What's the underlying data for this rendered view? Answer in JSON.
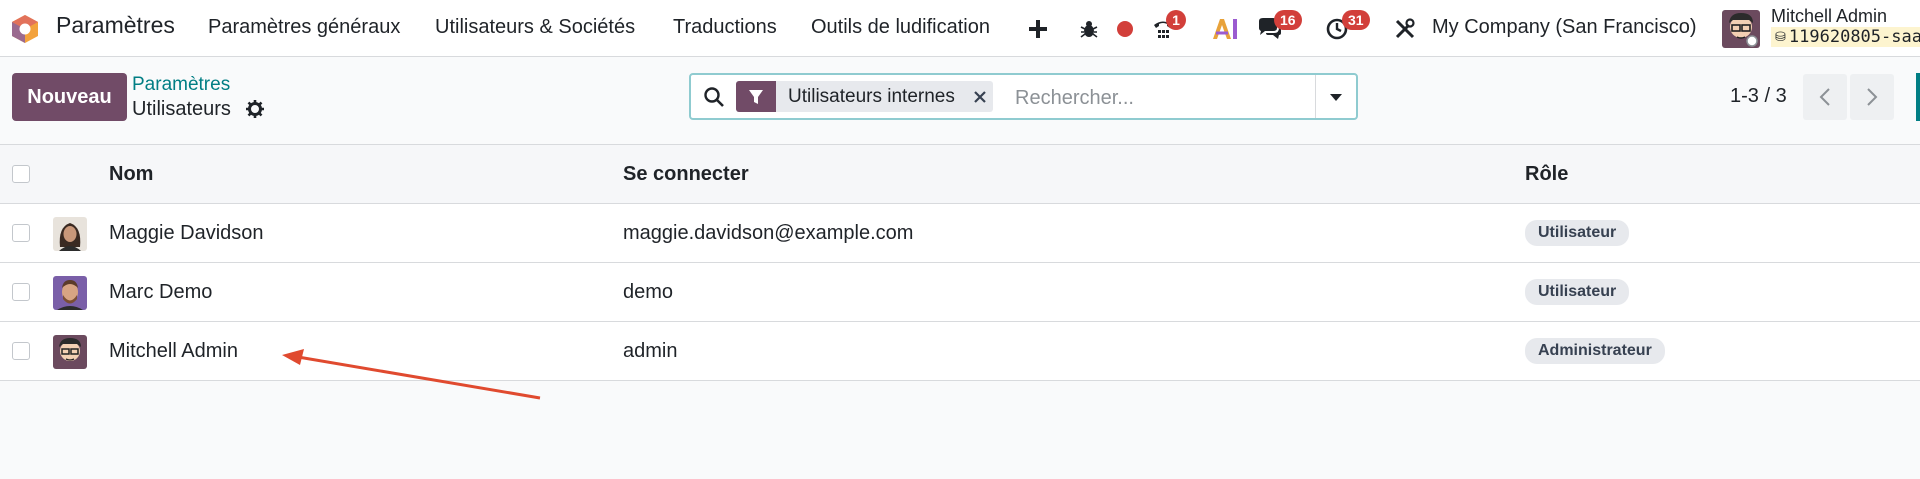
{
  "navbar": {
    "app_name": "Paramètres",
    "menu": [
      {
        "label": "Paramètres généraux"
      },
      {
        "label": "Utilisateurs & Sociétés"
      },
      {
        "label": "Traductions"
      },
      {
        "label": "Outils de ludification"
      }
    ],
    "badges": {
      "phone": "1",
      "messages": "16",
      "activities": "31"
    },
    "company": "My Company (San Francisco)",
    "user_name": "Mitchell Admin",
    "database": "119620805-saa"
  },
  "control_panel": {
    "new_button": "Nouveau",
    "breadcrumb_parent": "Paramètres",
    "breadcrumb_current": "Utilisateurs",
    "search": {
      "facet": "Utilisateurs internes",
      "placeholder": "Rechercher..."
    },
    "pager": "1-3 / 3"
  },
  "list": {
    "columns": {
      "name": "Nom",
      "login": "Se connecter",
      "role": "Rôle"
    },
    "rows": [
      {
        "name": "Maggie Davidson",
        "login": "maggie.davidson@example.com",
        "role": "Utilisateur"
      },
      {
        "name": "Marc Demo",
        "login": "demo",
        "role": "Utilisateur"
      },
      {
        "name": "Mitchell Admin",
        "login": "admin",
        "role": "Administrateur"
      }
    ]
  },
  "colors": {
    "brand": "#714b67",
    "accent": "#017e84",
    "badge": "#d23f3a",
    "annotation_arrow": "#e04a2f"
  }
}
